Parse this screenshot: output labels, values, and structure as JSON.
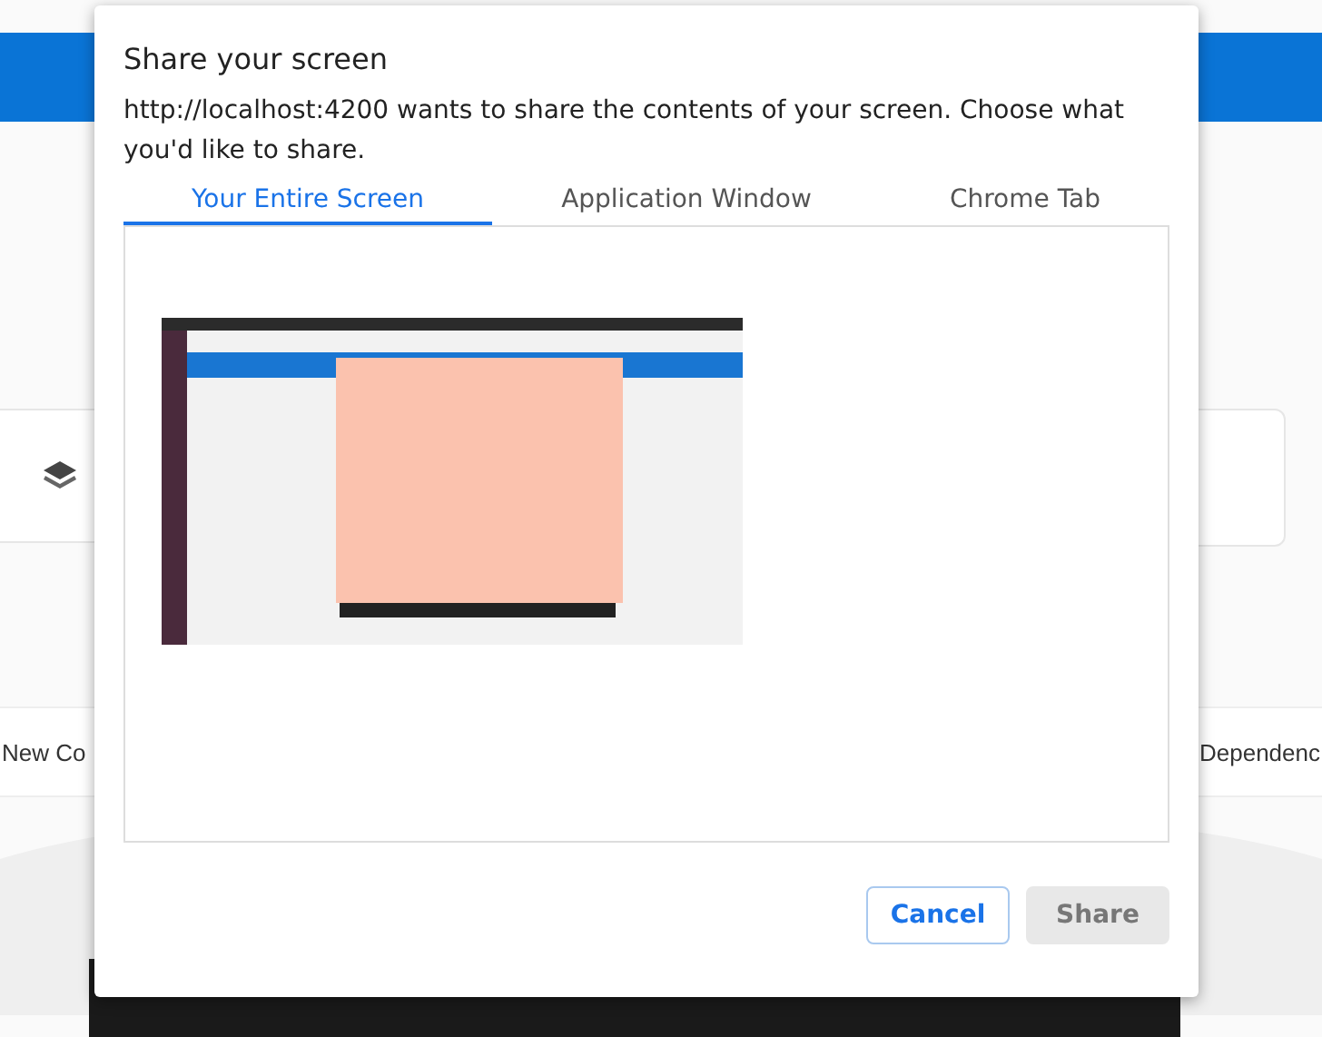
{
  "background": {
    "left_row_text": "New Co",
    "right_row_text": "Dependenc"
  },
  "dialog": {
    "title": "Share your screen",
    "message": "http://localhost:4200 wants to share the contents of your screen. Choose what you'd like to share.",
    "tabs": [
      {
        "label": "Your Entire Screen",
        "selected": true
      },
      {
        "label": "Application Window",
        "selected": false
      },
      {
        "label": "Chrome Tab",
        "selected": false
      }
    ],
    "buttons": [
      {
        "label": "Cancel",
        "disabled": false
      },
      {
        "label": "Share",
        "disabled": true
      }
    ]
  }
}
